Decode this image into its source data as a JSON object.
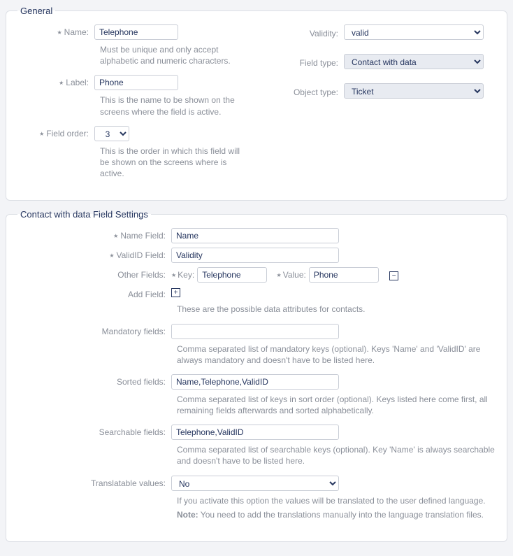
{
  "general": {
    "legend": "General",
    "name_label": "Name:",
    "name_value": "Telephone",
    "name_help": "Must be unique and only accept alphabetic and numeric characters.",
    "label_label": "Label:",
    "label_value": "Phone",
    "label_help": "This is the name to be shown on the screens where the field is active.",
    "fieldorder_label": "Field order:",
    "fieldorder_value": "3",
    "fieldorder_help": "This is the order in which this field will be shown on the screens where is active.",
    "validity_label": "Validity:",
    "validity_value": "valid",
    "fieldtype_label": "Field type:",
    "fieldtype_value": "Contact with data",
    "objecttype_label": "Object type:",
    "objecttype_value": "Ticket"
  },
  "settings": {
    "legend": "Contact with data Field Settings",
    "namefield_label": "Name Field:",
    "namefield_value": "Name",
    "valididfield_label": "ValidID Field:",
    "valididfield_value": "Validity",
    "otherfields_label": "Other Fields:",
    "kv_key_label": "Key:",
    "kv_key_value": "Telephone",
    "kv_value_label": "Value:",
    "kv_value_value": "Phone",
    "addfield_label": "Add Field:",
    "addfield_help": "These are the possible data attributes for contacts.",
    "mandatory_label": "Mandatory fields:",
    "mandatory_value": "",
    "mandatory_help": "Comma separated list of mandatory keys (optional). Keys 'Name' and 'ValidID' are always mandatory and doesn't have to be listed here.",
    "sorted_label": "Sorted fields:",
    "sorted_value": "Name,Telephone,ValidID",
    "sorted_help": "Comma separated list of keys in sort order (optional). Keys listed here come first, all remaining fields afterwards and sorted alphabetically.",
    "searchable_label": "Searchable fields:",
    "searchable_value": "Telephone,ValidID",
    "searchable_help": "Comma separated list of searchable keys (optional). Key 'Name' is always searchable and doesn't have to be listed here.",
    "translatable_label": "Translatable values:",
    "translatable_value": "No",
    "translatable_help1": "If you activate this option the values will be translated to the user defined language.",
    "translatable_note_label": "Note:",
    "translatable_help2": " You need to add the translations manually into the language translation files."
  }
}
